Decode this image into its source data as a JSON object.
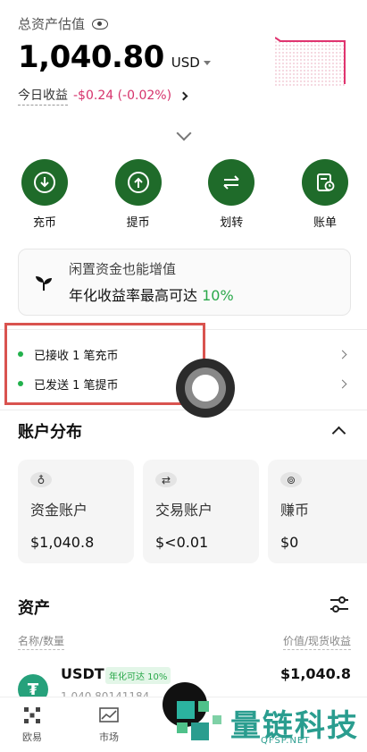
{
  "header": {
    "total_label": "总资产估值",
    "total_value": "1,040.80",
    "currency": "USD",
    "pnl_label": "今日收益",
    "pnl_value": "-$0.24 (-0.02%)"
  },
  "actions": [
    {
      "label": "充币",
      "icon": "deposit-icon"
    },
    {
      "label": "提币",
      "icon": "withdraw-icon"
    },
    {
      "label": "划转",
      "icon": "transfer-icon"
    },
    {
      "label": "账单",
      "icon": "bill-icon"
    }
  ],
  "promo": {
    "line1": "闲置资金也能增值",
    "line2_prefix": "年化收益率最高可达 ",
    "line2_value": "10%"
  },
  "notices": [
    {
      "text": "已接收 1 笔充币"
    },
    {
      "text": "已发送 1 笔提币"
    }
  ],
  "distribution": {
    "title": "账户分布",
    "cards": [
      {
        "name": "资金账户",
        "value": "$1,040.8",
        "icon": "wallet-bag-icon"
      },
      {
        "name": "交易账户",
        "value": "$<0.01",
        "icon": "exchange-icon"
      },
      {
        "name": "赚币",
        "value": "$0",
        "icon": "earn-icon"
      }
    ]
  },
  "assets": {
    "title": "资产",
    "col_left": "名称/数量",
    "col_right": "价值/现货收益",
    "rows": [
      {
        "symbol": "USDT",
        "badge": "年化可达 10%",
        "qty": "1,040.80141184",
        "value": "$1,040.8"
      }
    ]
  },
  "bottom_nav": [
    {
      "label": "欧易",
      "icon": "okx-logo-icon"
    },
    {
      "label": "市场",
      "icon": "market-chart-icon"
    }
  ],
  "watermark": {
    "text": "量链科技",
    "sub": "QFSP.NET"
  },
  "colors": {
    "brand_green": "#1f6b2a",
    "loss_red": "#d6336c",
    "gain_green": "#2aa84a",
    "highlight": "#d9534f"
  }
}
